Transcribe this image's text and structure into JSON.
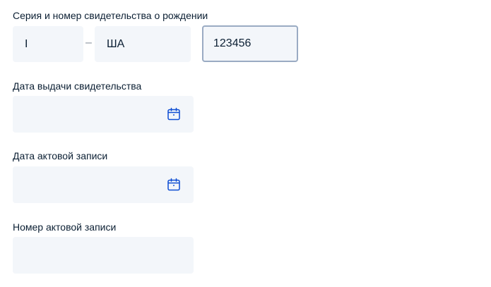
{
  "certificate": {
    "label": "Серия и номер свидетельства о рождении",
    "series_part1": "I",
    "separator": "–",
    "series_part2": "ША",
    "number": "123456"
  },
  "issue_date": {
    "label": "Дата выдачи свидетельства",
    "value": "",
    "icon": "calendar-icon"
  },
  "record_date": {
    "label": "Дата актовой записи",
    "value": "",
    "icon": "calendar-icon"
  },
  "record_number": {
    "label": "Номер актовой записи",
    "value": ""
  },
  "colors": {
    "field_bg": "#f3f6fa",
    "focus_border": "#9aabc3",
    "icon": "#0d4cd3",
    "text": "#0b1f33"
  }
}
